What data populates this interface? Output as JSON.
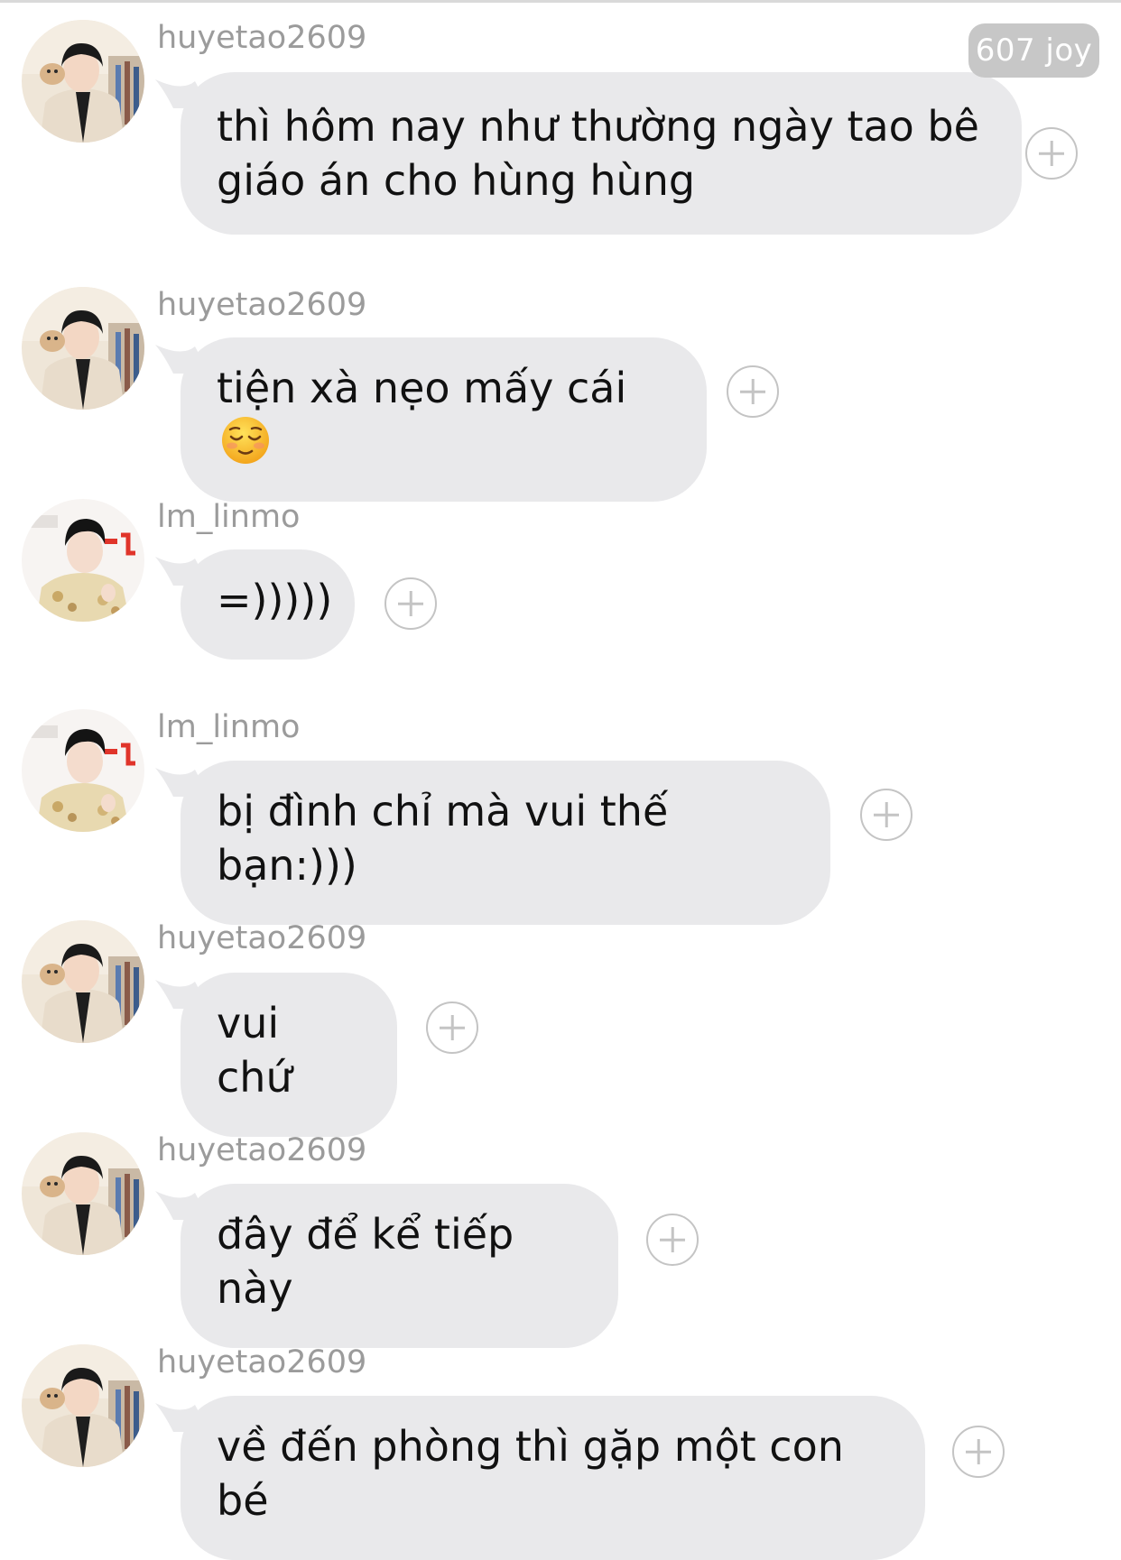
{
  "header": {
    "badge": "607 joy"
  },
  "messages": [
    {
      "username": "huyetao2609",
      "avatar": "avatar-huyetao",
      "text": "thì hôm nay như thường ngày tao bê\ngiáo án cho hùng hùng"
    },
    {
      "username": "huyetao2609",
      "avatar": "avatar-huyetao",
      "text": "tiện xà nẹo mấy cái",
      "emoji": "relieved-face-emoji"
    },
    {
      "username": "lm_linmo",
      "avatar": "avatar-linmo",
      "text": "=)))))"
    },
    {
      "username": "lm_linmo",
      "avatar": "avatar-linmo",
      "text": "bị đình chỉ mà vui thế bạn:)))"
    },
    {
      "username": "huyetao2609",
      "avatar": "avatar-huyetao",
      "text": "vui chứ"
    },
    {
      "username": "huyetao2609",
      "avatar": "avatar-huyetao",
      "text": "đây để kể tiếp này"
    },
    {
      "username": "huyetao2609",
      "avatar": "avatar-huyetao",
      "text": "về đến phòng thì gặp một con bé"
    }
  ],
  "colors": {
    "bubble": "#e9e9eb",
    "username": "#9b9b9b",
    "badge": "#c7c7c7"
  }
}
